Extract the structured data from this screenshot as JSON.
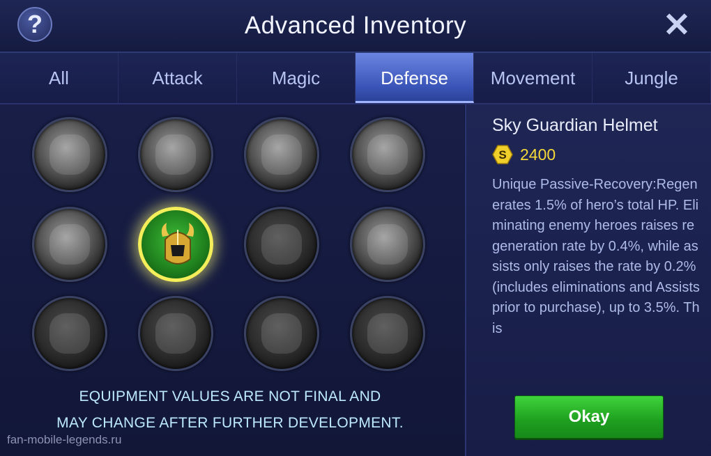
{
  "header": {
    "title": "Advanced Inventory",
    "help_symbol": "?",
    "close_symbol": "✕"
  },
  "tabs": [
    {
      "label": "All",
      "active": false
    },
    {
      "label": "Attack",
      "active": false
    },
    {
      "label": "Magic",
      "active": false
    },
    {
      "label": "Defense",
      "active": true
    },
    {
      "label": "Movement",
      "active": false
    },
    {
      "label": "Jungle",
      "active": false
    }
  ],
  "items": [
    {
      "icon": "defense-item-icon",
      "selected": false
    },
    {
      "icon": "defense-item-icon",
      "selected": false
    },
    {
      "icon": "defense-item-icon",
      "selected": false
    },
    {
      "icon": "defense-item-icon",
      "selected": false
    },
    {
      "icon": "defense-item-icon",
      "selected": false
    },
    {
      "icon": "sky-guardian-helmet-icon",
      "selected": true
    },
    {
      "icon": "defense-item-icon",
      "selected": false
    },
    {
      "icon": "defense-item-icon",
      "selected": false
    },
    {
      "icon": "defense-item-icon",
      "selected": false
    },
    {
      "icon": "defense-item-icon",
      "selected": false
    },
    {
      "icon": "defense-item-icon",
      "selected": false
    },
    {
      "icon": "defense-item-icon",
      "selected": false
    }
  ],
  "notice": {
    "line1": "EQUIPMENT VALUES ARE NOT FINAL AND",
    "line2": "MAY CHANGE AFTER FURTHER DEVELOPMENT."
  },
  "watermark": "fan-mobile-legends.ru",
  "detail": {
    "name": "Sky Guardian Helmet",
    "price": "2400",
    "description": "Unique Passive-Recovery:Regenerates 1.5% of hero’s total HP. Eliminating enemy heroes raises regeneration rate by 0.4%, while assists only raises the rate by 0.2% (includes eliminations and Assists prior to purchase), up to 3.5%. This",
    "okay_label": "Okay"
  },
  "colors": {
    "accent_tab": "#3a55b8",
    "gold": "#f5d83a",
    "okay_green": "#1e9e1f",
    "selected_ring": "#f3ee5a"
  }
}
